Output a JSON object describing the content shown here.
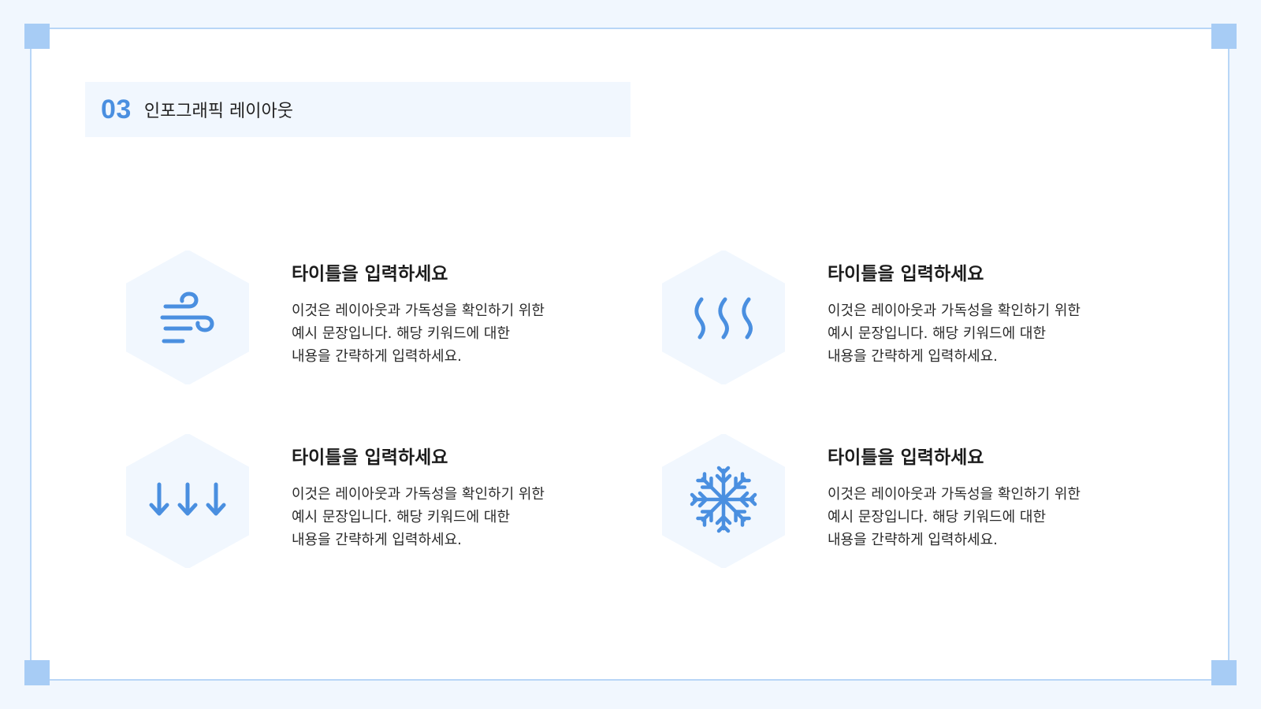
{
  "section": {
    "number": "03",
    "title": "인포그래픽 레이아웃"
  },
  "colors": {
    "accent": "#4a8fe0",
    "frame": "#b8d6f7",
    "hex_fill": "#f1f7fe",
    "background": "#f1f7fe"
  },
  "items": [
    {
      "icon": "wind-icon",
      "title": "타이틀을 입력하세요",
      "lines": [
        "이것은 레이아웃과 가독성을 확인하기 위한",
        "예시 문장입니다. 해당 키워드에 대한",
        "내용을 간략하게 입력하세요."
      ]
    },
    {
      "icon": "heat-waves-icon",
      "title": "타이틀을 입력하세요",
      "lines": [
        "이것은 레이아웃과 가독성을 확인하기 위한",
        "예시 문장입니다. 해당 키워드에 대한",
        "내용을 간략하게 입력하세요."
      ]
    },
    {
      "icon": "down-arrows-icon",
      "title": "타이틀을 입력하세요",
      "lines": [
        "이것은 레이아웃과 가독성을 확인하기 위한",
        "예시 문장입니다. 해당 키워드에 대한",
        "내용을 간략하게 입력하세요."
      ]
    },
    {
      "icon": "snowflake-icon",
      "title": "타이틀을 입력하세요",
      "lines": [
        "이것은 레이아웃과 가독성을 확인하기 위한",
        "예시 문장입니다. 해당 키워드에 대한",
        "내용을 간략하게 입력하세요."
      ]
    }
  ]
}
